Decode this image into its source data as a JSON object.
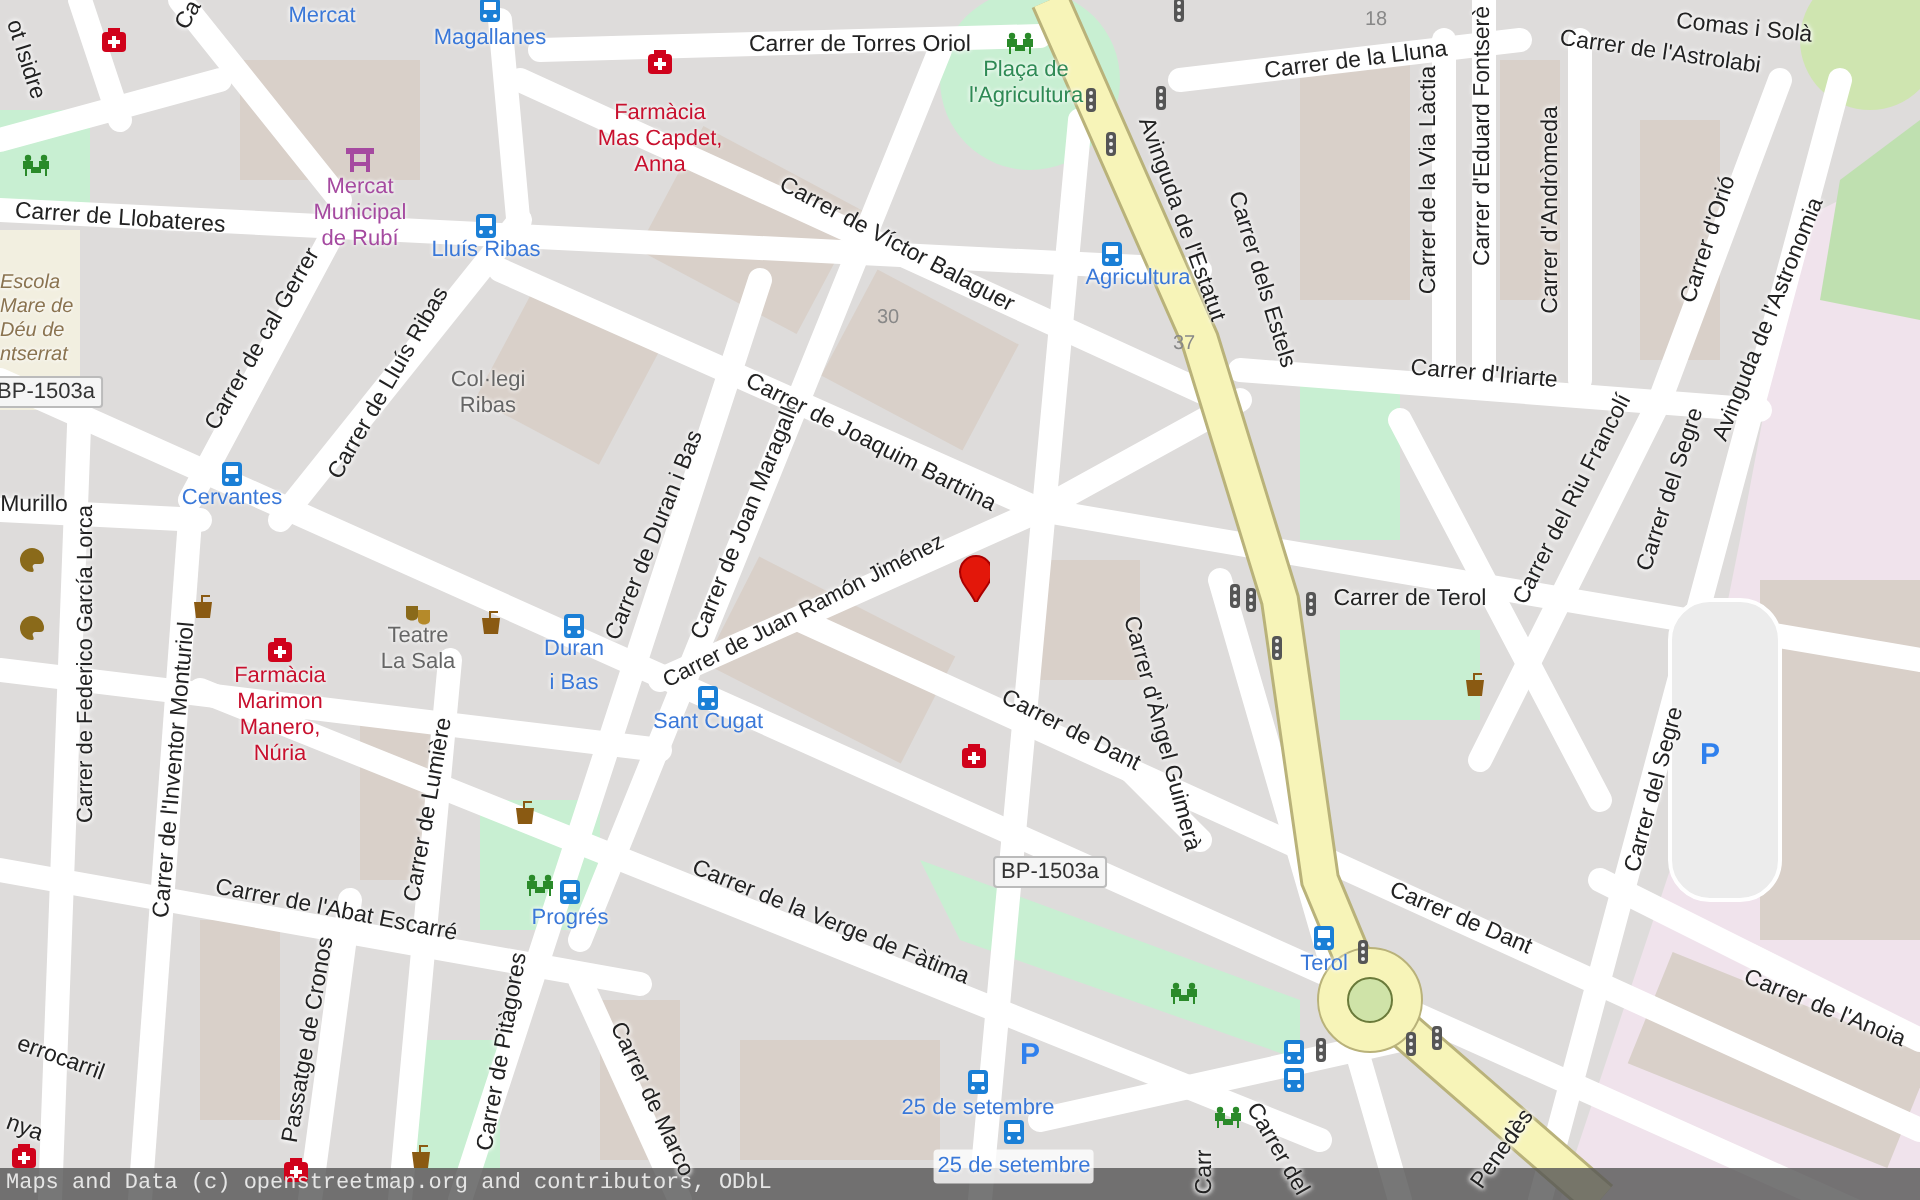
{
  "map": {
    "labels": [
      {
        "text": "Ca",
        "kind": "street"
      },
      {
        "text": "Mercat",
        "kind": "bus_stop"
      },
      {
        "text": "18",
        "kind": "house_number"
      },
      {
        "text": "Comas i Solà",
        "kind": "street"
      },
      {
        "text": "Magallanes",
        "kind": "bus_stop"
      },
      {
        "text": "Carrer de Torres Oriol",
        "kind": "street"
      },
      {
        "text": "ot Isidre",
        "kind": "street"
      },
      {
        "text": "Carrer de la Lluna",
        "kind": "street"
      },
      {
        "text": "Carrer de l'Astrolabi",
        "kind": "street"
      },
      {
        "text": "Plaça de\nl'Agricultura",
        "kind": "park"
      },
      {
        "text": "Farmàcia\nMas Capdet,\nAnna",
        "kind": "pharmacy"
      },
      {
        "text": "Carrer d'Eduard Fontserè",
        "kind": "street"
      },
      {
        "text": "Carrer de la Via Làctia",
        "kind": "street"
      },
      {
        "text": "Carrer d'Andròmeda",
        "kind": "street"
      },
      {
        "text": "Mercat\nMunicipal\nde Rubí",
        "kind": "marketplace"
      },
      {
        "text": "Carrer de Llobateres",
        "kind": "street"
      },
      {
        "text": "Avinguda de l'Estatut",
        "kind": "street"
      },
      {
        "text": "Carrer d'Orió",
        "kind": "street"
      },
      {
        "text": "Lluís Ribas",
        "kind": "bus_stop"
      },
      {
        "text": "Carrer de Víctor Balaguer",
        "kind": "street"
      },
      {
        "text": "Carrer dels Estels",
        "kind": "street"
      },
      {
        "text": "Agricultura",
        "kind": "bus_stop"
      },
      {
        "text": "Avinguda de l'Astronomia",
        "kind": "street"
      },
      {
        "text": "30",
        "kind": "house_number"
      },
      {
        "text": "Escola\nMare de\nDéu de\nntserrat",
        "kind": "school"
      },
      {
        "text": "37",
        "kind": "house_number"
      },
      {
        "text": "Carrer de cal Gerrer",
        "kind": "street"
      },
      {
        "text": "Carrer d'Iriarte",
        "kind": "street"
      },
      {
        "text": "Carrer de Lluís Ribas",
        "kind": "street"
      },
      {
        "text": "BP-1503a",
        "kind": "road_ref"
      },
      {
        "text": "Col·legi\nRibas",
        "kind": "building"
      },
      {
        "text": "Carrer de Joaquim Bartrina",
        "kind": "street"
      },
      {
        "text": "Carrer del Segre",
        "kind": "street"
      },
      {
        "text": "Carrer del Riu Francolí",
        "kind": "street"
      },
      {
        "text": "Cervantes",
        "kind": "bus_stop"
      },
      {
        "text": "Murillo",
        "kind": "street"
      },
      {
        "text": "Carrer de Duran i Bas",
        "kind": "street"
      },
      {
        "text": "Carrer de Joan Maragall",
        "kind": "street"
      },
      {
        "text": "Carrer de Juan Ramón Jiménez",
        "kind": "street"
      },
      {
        "text": "Carrer de Federico García Lorca",
        "kind": "street"
      },
      {
        "text": "Carrer de Terol",
        "kind": "street"
      },
      {
        "text": "Teatre\nLa Sala",
        "kind": "building"
      },
      {
        "text": "Duran\ni Bas",
        "kind": "bus_stop"
      },
      {
        "text": "Farmàcia\nMarimon\nManero,\nNúria",
        "kind": "pharmacy"
      },
      {
        "text": "Sant Cugat",
        "kind": "bus_stop"
      },
      {
        "text": "Carrer de Dant",
        "kind": "street"
      },
      {
        "text": "Carrer d'Àngel Guimerà",
        "kind": "street"
      },
      {
        "text": "Carrer de l'Inventor Monturiol",
        "kind": "street"
      },
      {
        "text": "P",
        "kind": "parking"
      },
      {
        "text": "Carrer del Segre",
        "kind": "street"
      },
      {
        "text": "Carrer de Lumière",
        "kind": "street"
      },
      {
        "text": "BP-1503a",
        "kind": "road_ref"
      },
      {
        "text": "Carrer de l'Abat Escarré",
        "kind": "street"
      },
      {
        "text": "Carrer de Dant",
        "kind": "street"
      },
      {
        "text": "Progrés",
        "kind": "bus_stop"
      },
      {
        "text": "Carrer de la Verge de Fàtima",
        "kind": "street"
      },
      {
        "text": "Terol",
        "kind": "bus_stop"
      },
      {
        "text": "Carrer de l'Anoia",
        "kind": "street"
      },
      {
        "text": "errocarril",
        "kind": "street"
      },
      {
        "text": "P",
        "kind": "parking"
      },
      {
        "text": "Passatge de Cronos",
        "kind": "street"
      },
      {
        "text": "Carrer de Pitàgores",
        "kind": "street"
      },
      {
        "text": "Carrer de Marco",
        "kind": "street"
      },
      {
        "text": "25 de setembre",
        "kind": "bus_stop"
      },
      {
        "text": "nya",
        "kind": "street"
      },
      {
        "text": "Penedès",
        "kind": "street"
      },
      {
        "text": "Carrer del",
        "kind": "street"
      },
      {
        "text": "25 de setembre",
        "kind": "bus_stop"
      },
      {
        "text": "Carr",
        "kind": "street"
      }
    ]
  },
  "attribution": "Maps and Data (c) openstreetmap.org and contributors, ODbL"
}
